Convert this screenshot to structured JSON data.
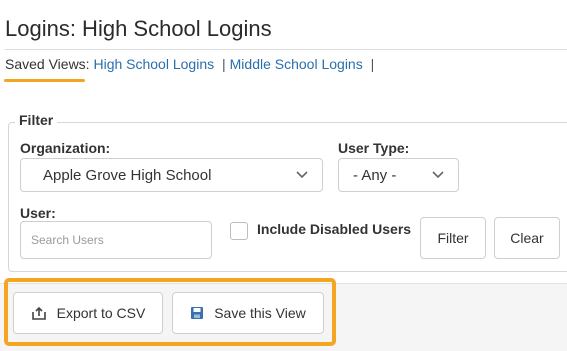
{
  "page": {
    "title": "Logins: High School Logins"
  },
  "saved_views": {
    "label": "Saved Views:",
    "links": [
      "High School Logins",
      "Middle School Logins"
    ],
    "separator": "|"
  },
  "filter": {
    "legend": "Filter",
    "organization": {
      "label": "Organization:",
      "value": "Apple Grove High School"
    },
    "user_type": {
      "label": "User Type:",
      "value": "- Any -"
    },
    "user": {
      "label": "User:",
      "placeholder": "Search Users"
    },
    "include_disabled": {
      "label": "Include Disabled Users",
      "checked": false
    },
    "filter_button": "Filter",
    "clear_button": "Clear"
  },
  "actions": {
    "export_label": "Export to CSV",
    "save_view_label": "Save this View",
    "export_icon": "export-icon",
    "save_icon": "save-disk-icon"
  },
  "colors": {
    "link": "#2a6fad",
    "highlight": "#f4a623",
    "save_icon": "#3a6fb0"
  }
}
